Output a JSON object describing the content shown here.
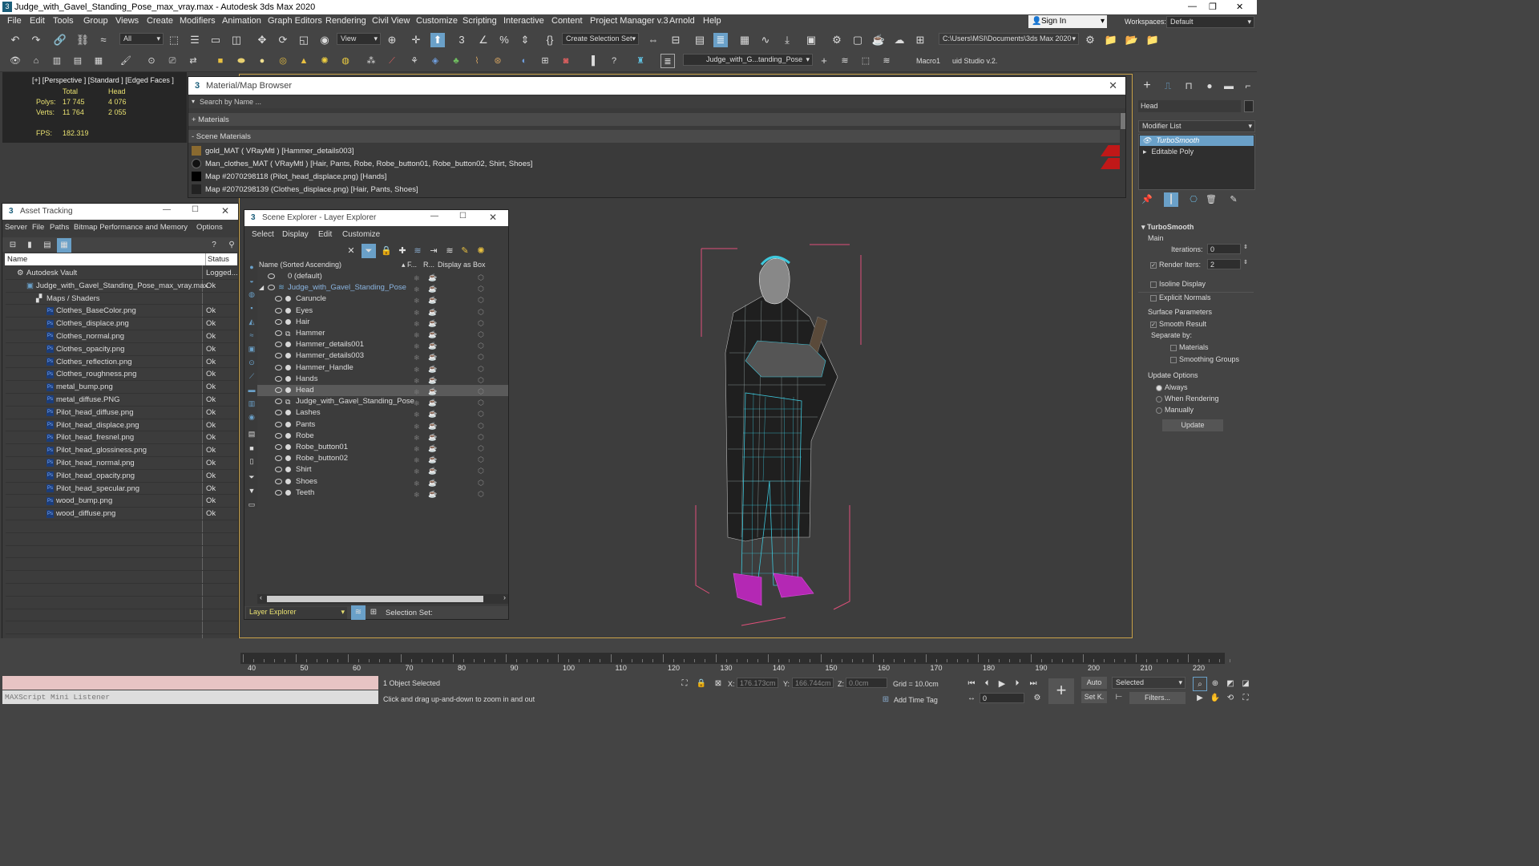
{
  "titlebar": {
    "title": "Judge_with_Gavel_Standing_Pose_max_vray.max - Autodesk 3ds Max 2020"
  },
  "menu": [
    "File",
    "Edit",
    "Tools",
    "Group",
    "Views",
    "Create",
    "Modifiers",
    "Animation",
    "Graph Editors",
    "Rendering",
    "Civil View",
    "Customize",
    "Scripting",
    "Interactive",
    "Content",
    "Project Manager v.3",
    "Arnold",
    "Help"
  ],
  "signin": "Sign In",
  "workspaces_label": "Workspaces:",
  "workspaces_value": "Default",
  "toolbar": {
    "filter_all": "All",
    "view": "View",
    "create_selection_set": "Create Selection Set",
    "project_path": "C:\\Users\\MSI\\Documents\\3ds Max 2020",
    "scene_layer": "Judge_with_G...tanding_Pose",
    "macro1": "Macro1",
    "studio": "uid Studio v.2."
  },
  "viewport": {
    "label": "[+] [Perspective ] [Standard ] [Edged Faces ]",
    "stats": {
      "total_h": "Total",
      "head_h": "Head",
      "polys_label": "Polys:",
      "polys_total": "17 745",
      "polys_head": "4 076",
      "verts_label": "Verts:",
      "verts_total": "11 764",
      "verts_head": "2 055",
      "fps_label": "FPS:",
      "fps_value": "182.319"
    }
  },
  "material_browser": {
    "title": "Material/Map Browser",
    "search_placeholder": "Search by Name ...",
    "materials_group": "+ Materials",
    "scene_materials_group": "- Scene Materials",
    "rows": [
      "gold_MAT  ( VRayMtl )  [Hammer_details003]",
      "Man_clothes_MAT  ( VRayMtl )  [Hair, Pants, Robe, Robe_button01, Robe_button02, Shirt, Shoes]",
      "Map #2070298118 (Pilot_head_displace.png)  [Hands]",
      "Map #2070298139 (Clothes_displace.png)  [Hair, Pants, Shoes]"
    ]
  },
  "asset_tracking": {
    "title": "Asset Tracking",
    "menu": [
      "Server",
      "File",
      "Paths",
      "Bitmap Performance and Memory",
      "Options"
    ],
    "col_name": "Name",
    "col_status": "Status",
    "vault": {
      "name": "Autodesk Vault",
      "status": "Logged..."
    },
    "scene_file": {
      "name": "Judge_with_Gavel_Standing_Pose_max_vray.max",
      "status": "Ok"
    },
    "maps_folder": "Maps / Shaders",
    "files": [
      {
        "name": "Clothes_BaseColor.png",
        "status": "Ok"
      },
      {
        "name": "Clothes_displace.png",
        "status": "Ok"
      },
      {
        "name": "Clothes_normal.png",
        "status": "Ok"
      },
      {
        "name": "Clothes_opacity.png",
        "status": "Ok"
      },
      {
        "name": "Clothes_reflection.png",
        "status": "Ok"
      },
      {
        "name": "Clothes_roughness.png",
        "status": "Ok"
      },
      {
        "name": "metal_bump.png",
        "status": "Ok"
      },
      {
        "name": "metal_diffuse.PNG",
        "status": "Ok"
      },
      {
        "name": "Pilot_head_diffuse.png",
        "status": "Ok"
      },
      {
        "name": "Pilot_head_displace.png",
        "status": "Ok"
      },
      {
        "name": "Pilot_head_fresnel.png",
        "status": "Ok"
      },
      {
        "name": "Pilot_head_glossiness.png",
        "status": "Ok"
      },
      {
        "name": "Pilot_head_normal.png",
        "status": "Ok"
      },
      {
        "name": "Pilot_head_opacity.png",
        "status": "Ok"
      },
      {
        "name": "Pilot_head_specular.png",
        "status": "Ok"
      },
      {
        "name": "wood_bump.png",
        "status": "Ok"
      },
      {
        "name": "wood_diffuse.png",
        "status": "Ok"
      }
    ]
  },
  "scene_explorer": {
    "title": "Scene Explorer - Layer Explorer",
    "menu": [
      "Select",
      "Display",
      "Edit",
      "Customize"
    ],
    "col_name": "Name (Sorted Ascending)",
    "col_f": "▴ F...",
    "col_r": "R...",
    "col_box": "Display as Box",
    "default_layer": "0 (default)",
    "root_layer": "Judge_with_Gavel_Standing_Pose",
    "objects": [
      "Caruncle",
      "Eyes",
      "Hair",
      "Hammer",
      "Hammer_details001",
      "Hammer_details003",
      "Hammer_Handle",
      "Hands",
      "Head",
      "Judge_with_Gavel_Standing_Pose",
      "Lashes",
      "Pants",
      "Robe",
      "Robe_button01",
      "Robe_button02",
      "Shirt",
      "Shoes",
      "Teeth"
    ],
    "selected": "Head",
    "footer_mode": "Layer Explorer",
    "selection_set": "Selection Set:"
  },
  "command_panel": {
    "object_name": "Head",
    "modifier_list": "Modifier List",
    "stack": [
      "TurboSmooth",
      "Editable Poly"
    ],
    "rollout_title": "TurboSmooth",
    "main": "Main",
    "iterations_label": "Iterations:",
    "iterations": "0",
    "render_iters_label": "Render Iters:",
    "render_iters": "2",
    "isoline": "Isoline Display",
    "explicit_normals": "Explicit Normals",
    "surface_params": "Surface Parameters",
    "smooth_result": "Smooth Result",
    "separate_by": "Separate by:",
    "materials": "Materials",
    "smoothing_groups": "Smoothing Groups",
    "update_options": "Update Options",
    "always": "Always",
    "when_rendering": "When Rendering",
    "manually": "Manually",
    "update": "Update"
  },
  "timeline": {
    "ticks": [
      "40",
      "50",
      "60",
      "70",
      "80",
      "90",
      "100",
      "110",
      "120",
      "130",
      "140",
      "150",
      "160",
      "170",
      "180",
      "190",
      "200",
      "210",
      "220"
    ]
  },
  "status": {
    "maxscript": "MAXScript Mini Listener",
    "selected": "1 Object Selected",
    "hint": "Click and drag up-and-down to zoom in and out",
    "x_label": "X:",
    "x": "176.173cm",
    "y_label": "Y:",
    "y": "166.744cm",
    "z_label": "Z:",
    "z": "0.0cm",
    "grid": "Grid = 10.0cm",
    "add_time_tag": "Add Time Tag",
    "auto": "Auto",
    "setk": "Set K.",
    "selected_dd": "Selected",
    "filters": "Filters...",
    "frame": "0"
  }
}
